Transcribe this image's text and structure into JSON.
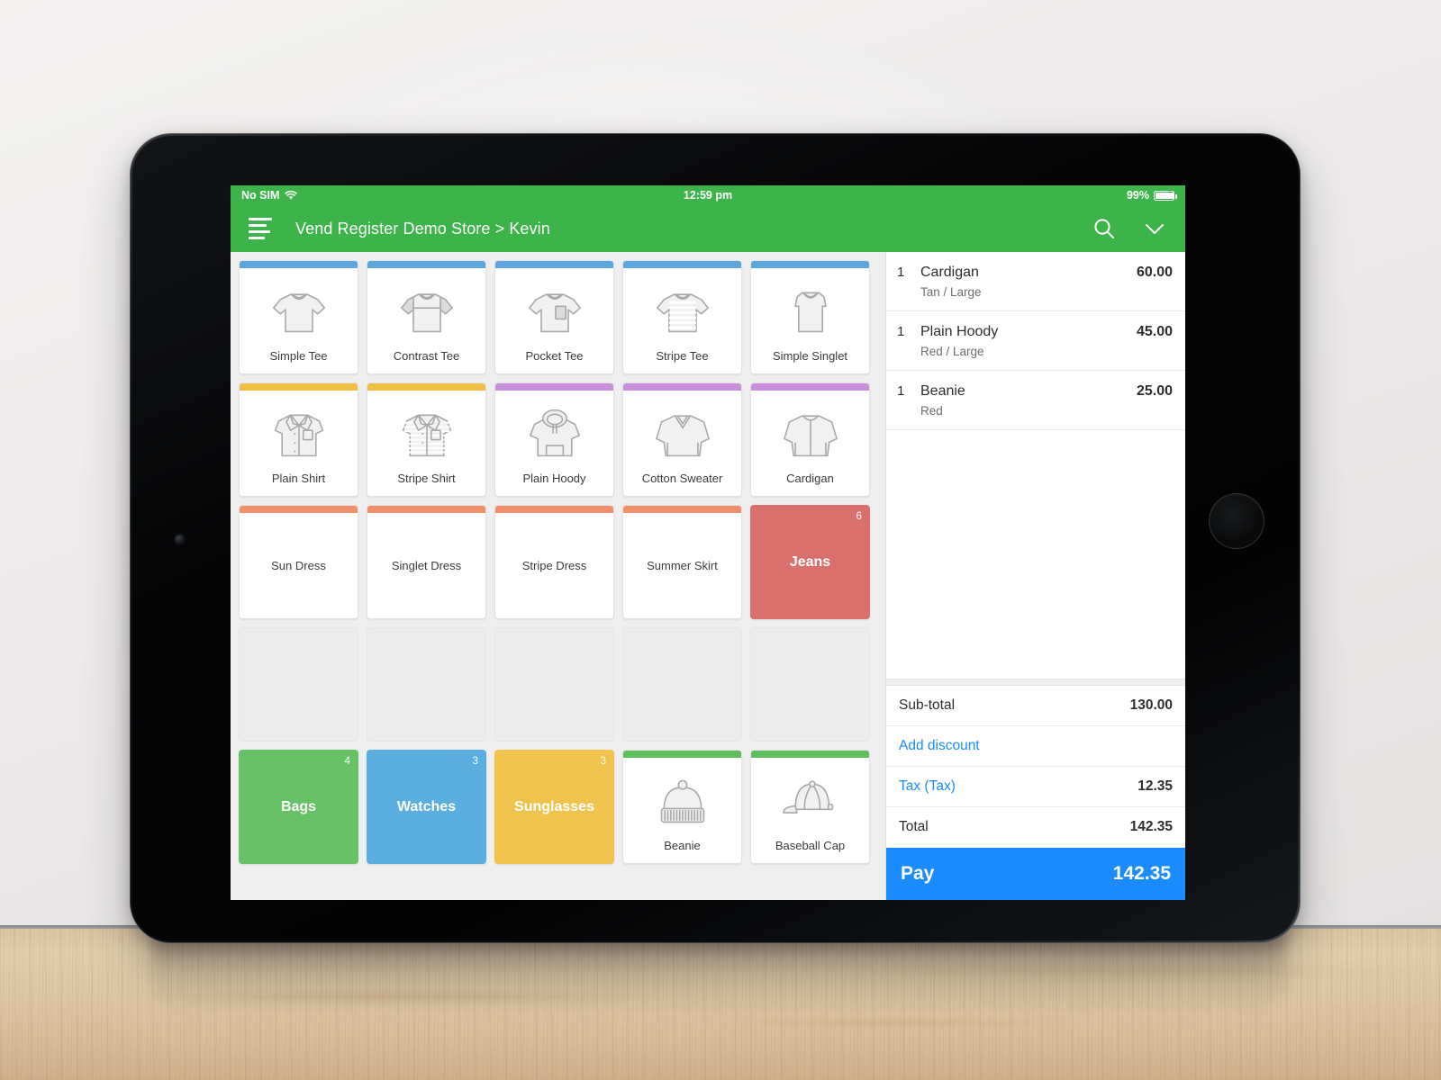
{
  "status_bar": {
    "carrier": "No SIM",
    "wifi_icon": "wifi-icon",
    "time": "12:59 pm",
    "battery_percent": "99%"
  },
  "nav": {
    "menu_icon": "hamburger-menu-icon",
    "title": "Vend Register Demo Store > Kevin",
    "search_icon": "search-icon",
    "chevron_icon": "chevron-down-icon"
  },
  "colors": {
    "header_green": "#3cb44a",
    "bar_blue": "#5ba7dc",
    "bar_yellow": "#efc044",
    "bar_purple": "#c98fdb",
    "bar_orange": "#f0906a",
    "bar_green": "#5cbe5c",
    "tile_jeans": "#d9706e",
    "tile_bags": "#67c267",
    "tile_watches": "#5bafe0",
    "tile_sunglasses": "#f0c44c",
    "pay_blue": "#1a8cff",
    "link_blue": "#1a8cff"
  },
  "grid": {
    "tiles": [
      {
        "label": "Simple Tee",
        "kind": "product",
        "bar": "#5ba7dc",
        "art": "tee"
      },
      {
        "label": "Contrast Tee",
        "kind": "product",
        "bar": "#5ba7dc",
        "art": "tee-contrast"
      },
      {
        "label": "Pocket Tee",
        "kind": "product",
        "bar": "#5ba7dc",
        "art": "tee-pocket"
      },
      {
        "label": "Stripe Tee",
        "kind": "product",
        "bar": "#5ba7dc",
        "art": "tee-stripe"
      },
      {
        "label": "Simple Singlet",
        "kind": "product",
        "bar": "#5ba7dc",
        "art": "singlet"
      },
      {
        "label": "Plain Shirt",
        "kind": "product",
        "bar": "#efc044",
        "art": "shirt"
      },
      {
        "label": "Stripe Shirt",
        "kind": "product",
        "bar": "#efc044",
        "art": "shirt-stripe"
      },
      {
        "label": "Plain Hoody",
        "kind": "product",
        "bar": "#c98fdb",
        "art": "hoody"
      },
      {
        "label": "Cotton Sweater",
        "kind": "product",
        "bar": "#c98fdb",
        "art": "sweater"
      },
      {
        "label": "Cardigan",
        "kind": "product",
        "bar": "#c98fdb",
        "art": "cardigan"
      },
      {
        "label": "Sun Dress",
        "kind": "text",
        "bar": "#f0906a"
      },
      {
        "label": "Singlet Dress",
        "kind": "text",
        "bar": "#f0906a"
      },
      {
        "label": "Stripe Dress",
        "kind": "text",
        "bar": "#f0906a"
      },
      {
        "label": "Summer Skirt",
        "kind": "text",
        "bar": "#f0906a"
      },
      {
        "label": "Jeans",
        "kind": "category",
        "fill": "#d9706e",
        "count": "6"
      },
      {
        "label": "",
        "kind": "empty"
      },
      {
        "label": "",
        "kind": "empty"
      },
      {
        "label": "",
        "kind": "empty"
      },
      {
        "label": "",
        "kind": "empty"
      },
      {
        "label": "",
        "kind": "empty"
      },
      {
        "label": "Bags",
        "kind": "category",
        "fill": "#67c267",
        "count": "4"
      },
      {
        "label": "Watches",
        "kind": "category",
        "fill": "#5bafe0",
        "count": "3"
      },
      {
        "label": "Sunglasses",
        "kind": "category",
        "fill": "#f0c44c",
        "count": "3"
      },
      {
        "label": "Beanie",
        "kind": "product",
        "bar": "#5cbe5c",
        "art": "beanie"
      },
      {
        "label": "Baseball Cap",
        "kind": "product",
        "bar": "#5cbe5c",
        "art": "cap"
      }
    ]
  },
  "cart": {
    "items": [
      {
        "qty": "1",
        "name": "Cardigan",
        "variant": "Tan / Large",
        "price": "60.00"
      },
      {
        "qty": "1",
        "name": "Plain Hoody",
        "variant": "Red / Large",
        "price": "45.00"
      },
      {
        "qty": "1",
        "name": "Beanie",
        "variant": "Red",
        "price": "25.00"
      }
    ],
    "totals": [
      {
        "label": "Sub-total",
        "value": "130.00",
        "link": false
      },
      {
        "label": "Add discount",
        "value": "",
        "link": true
      },
      {
        "label": "Tax (Tax)",
        "value": "12.35",
        "link": true
      },
      {
        "label": "Total",
        "value": "142.35",
        "link": false
      }
    ],
    "pay_label": "Pay",
    "pay_amount": "142.35"
  }
}
